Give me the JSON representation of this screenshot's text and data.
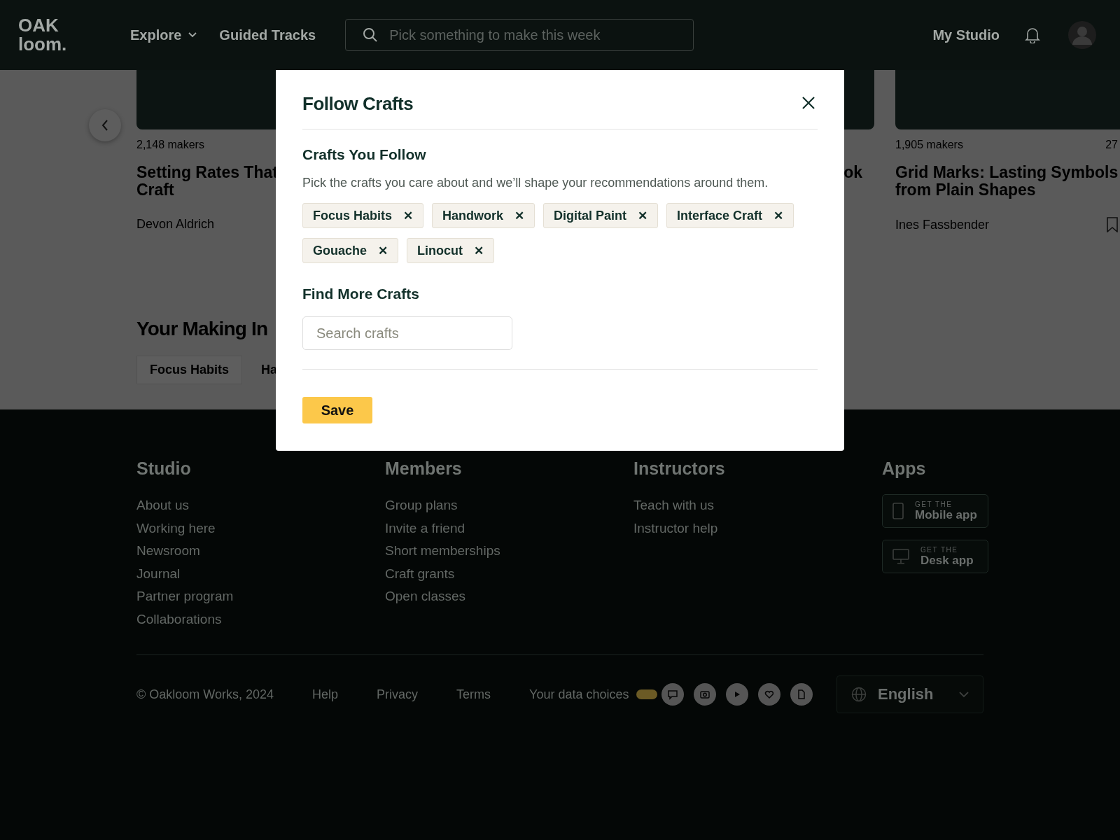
{
  "header": {
    "logo_lines": [
      "OAK",
      "loom."
    ],
    "nav": [
      {
        "label": "Explore",
        "kind": "dropdown"
      },
      {
        "label": "Guided Tracks",
        "kind": "link"
      }
    ],
    "search": {
      "placeholder": "Pick something to make this week"
    },
    "account_link": "My Studio"
  },
  "carousel": {
    "cards": [
      {
        "makers": "2,148 makers",
        "title_lines": [
          "Setting Rates That",
          "Craft"
        ],
        "author": "Devon Aldrich"
      },
      {
        "title_lines": [
          "ok"
        ]
      },
      {
        "makers": "1,905 makers",
        "duration": "27",
        "title_lines": [
          "Grid Marks: Lasting Symbols",
          "from Plain Shapes"
        ],
        "author": "Ines Fassbender",
        "bookmark": true
      }
    ]
  },
  "interests": {
    "heading": "Your Making In",
    "chips": [
      "Focus Habits",
      "Ha"
    ]
  },
  "modal": {
    "title": "Follow Crafts",
    "followed": {
      "heading": "Crafts You Follow",
      "description": "Pick the crafts you care about and we’ll shape your recommendations around them.",
      "chips": [
        {
          "label": "Focus Habits",
          "remove": "✕"
        },
        {
          "label": "Handwork",
          "remove": "✕"
        },
        {
          "label": "Digital Paint",
          "remove": "✕"
        },
        {
          "label": "Interface Craft",
          "remove": "✕"
        },
        {
          "label": "Gouache",
          "remove": "✕"
        },
        {
          "label": "Linocut",
          "remove": "✕"
        }
      ]
    },
    "find": {
      "heading": "Find More Crafts",
      "search": {
        "placeholder": "Search crafts"
      }
    },
    "save_button": "Save"
  },
  "footer": {
    "columns": [
      {
        "heading": "Studio",
        "links": [
          "About us",
          "Working here",
          "Newsroom",
          "Journal",
          "Partner program",
          "Collaborations"
        ]
      },
      {
        "heading": "Members",
        "links": [
          "Group plans",
          "Invite a friend",
          "Short memberships",
          "Craft grants",
          "Open classes"
        ]
      },
      {
        "heading": "Instructors",
        "links": [
          "Teach with us",
          "Instructor help"
        ]
      },
      {
        "heading": "Apps",
        "apps": [
          {
            "kind": "mobile",
            "small": "GET THE",
            "label": "Mobile app"
          },
          {
            "kind": "desktop",
            "small": "GET THE",
            "label": "Desk app"
          }
        ]
      }
    ],
    "copyright": "© Oakloom Works, 2024",
    "links": [
      "Help",
      "Privacy",
      "Terms"
    ],
    "data_choices": {
      "label": "Your data choices",
      "on": true
    },
    "social": [
      {
        "kind": "chat"
      },
      {
        "kind": "camera"
      },
      {
        "kind": "play"
      },
      {
        "kind": "heart"
      },
      {
        "kind": "file"
      }
    ],
    "language": "English"
  }
}
